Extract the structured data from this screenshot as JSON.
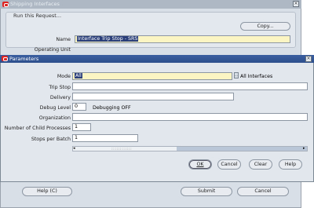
{
  "back_window": {
    "title": "Shipping Interfaces",
    "group_label": "Run this Request...",
    "copy_label": "Copy...",
    "name_label": "Name",
    "name_value": "Interface Trip Stop - SRS",
    "operating_unit_label": "Operating Unit",
    "help_label": "Help (C)",
    "submit_label": "Submit",
    "cancel_label": "Cancel"
  },
  "params_dialog": {
    "title": "Parameters",
    "mode_label": "Mode",
    "mode_value": "All",
    "mode_desc": "All Interfaces",
    "trip_stop_label": "Trip Stop",
    "delivery_label": "Delivery",
    "debug_level_label": "Debug Level",
    "debug_level_value": "0",
    "debug_desc": "Debugging OFF",
    "organization_label": "Organization",
    "child_processes_label": "Number of Child Processes",
    "child_processes_value": "1",
    "stops_per_batch_label": "Stops per Batch",
    "stops_per_batch_value": "1",
    "ok_label": "OK",
    "cancel_label": "Cancel",
    "clear_label": "Clear",
    "help_label": "Help"
  },
  "colors": {
    "title_active": "#2d4f8c",
    "title_inactive": "#aeb8c4",
    "selected_field": "#fbf5c4",
    "window_bg": "#e2e7ed"
  }
}
